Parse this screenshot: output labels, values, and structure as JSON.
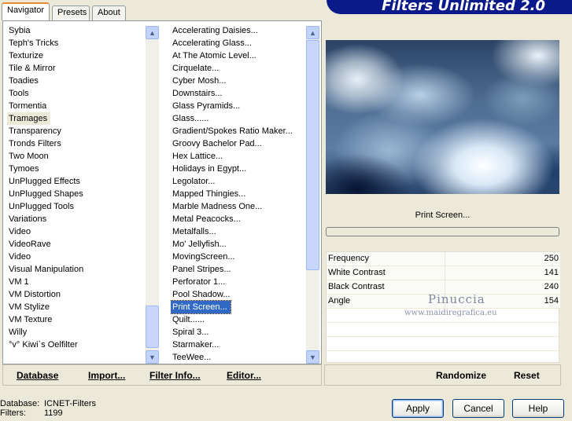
{
  "tabs": [
    {
      "label": "Navigator",
      "active": true
    },
    {
      "label": "Presets",
      "active": false
    },
    {
      "label": "About",
      "active": false
    }
  ],
  "banner": {
    "title": "Filters Unlimited 2.0"
  },
  "categories": {
    "items": [
      "Sybia",
      "Teph's Tricks",
      "Texturize",
      "Tile & Mirror",
      "Toadies",
      "Tools",
      "Tormentia",
      "Tramages",
      "Transparency",
      "Tronds Filters",
      "Two Moon",
      "Tymoes",
      "UnPlugged Effects",
      "UnPlugged Shapes",
      "UnPlugged Tools",
      "Variations",
      "Video",
      "VideoRave",
      "Video",
      "Visual Manipulation",
      "VM 1",
      "VM Distortion",
      "VM Stylize",
      "VM Texture",
      "Willy",
      "°v° Kiwi`s Oelfilter"
    ],
    "selected_index": 7
  },
  "filters": {
    "items": [
      "Accelerating Daisies...",
      "Accelerating Glass...",
      "At The Atomic Level...",
      "Cirquelate...",
      "Cyber Mosh...",
      "Downstairs...",
      "Glass Pyramids...",
      "Glass......",
      "Gradient/Spokes Ratio Maker...",
      "Groovy Bachelor Pad...",
      "Hex Lattice...",
      "Holidays in Egypt...",
      "Legolator...",
      "Mapped Thingies...",
      "Marble Madness One...",
      "Metal Peacocks...",
      "Metalfalls...",
      "Mo' Jellyfish...",
      "MovingScreen...",
      "Panel Stripes...",
      "Perforator 1...",
      "Pool Shadow...",
      "Print Screen...",
      "Quilt......",
      "Spiral 3...",
      "Starmaker...",
      "TeeWee..."
    ],
    "selected_index": 22
  },
  "bottom_buttons": {
    "database": "Database",
    "import": "Import...",
    "filter_info": "Filter Info...",
    "editor": "Editor..."
  },
  "preview": {
    "filter_name": "Print Screen..."
  },
  "progress": {
    "value": 0
  },
  "params": [
    {
      "label": "Frequency",
      "value": "250"
    },
    {
      "label": "White Contrast",
      "value": "141"
    },
    {
      "label": "Black Contrast",
      "value": "240"
    },
    {
      "label": "Angle",
      "value": "154"
    }
  ],
  "watermark": {
    "name": "Pinuccia",
    "url": "www.maidiregrafica.eu"
  },
  "right_buttons": {
    "randomize": "Randomize",
    "reset": "Reset"
  },
  "status": {
    "database_label": "Database:",
    "database_value": "ICNET-Filters",
    "filters_label": "Filters:",
    "filters_value": "1199"
  },
  "dialog_buttons": {
    "apply": "Apply",
    "cancel": "Cancel",
    "help": "Help"
  },
  "icons": {
    "scroll_up": "chevron-up-icon",
    "scroll_down": "chevron-down-icon"
  },
  "colors": {
    "banner": "#0a1a8a",
    "selection": "#316ac5",
    "active_tab_accent": "#e68b2c"
  }
}
